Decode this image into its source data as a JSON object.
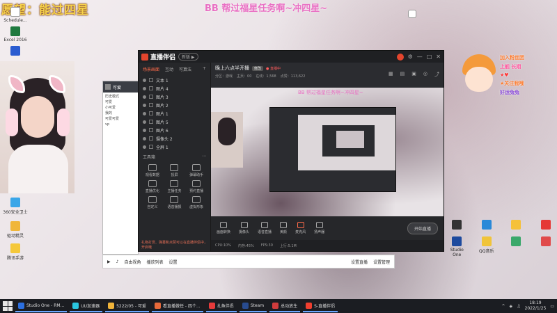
{
  "overlay": {
    "left_title": "愿望：能过四星",
    "center_title": "BB 帮过福星任务啊~冲四星~"
  },
  "desktop_left_icons": [
    {
      "label": "Schedule...",
      "icon": "doc-icon"
    },
    {
      "label": "Excel 2016",
      "icon": "excel-icon"
    },
    {
      "label": "",
      "icon": "word-icon"
    },
    {
      "label": "360安全卫士",
      "icon": "shield-icon"
    },
    {
      "label": "驱动精灵",
      "icon": "driver-icon"
    },
    {
      "label": "腾讯手游",
      "icon": "game-icon"
    }
  ],
  "chat_window": {
    "title": "可爱",
    "rows": [
      "历史模式",
      "可爱",
      "小可爱",
      "我的",
      "可爱可爱",
      "vp"
    ]
  },
  "main_window": {
    "app_name": "直播伴侣",
    "version_pill": "新版 ▶",
    "left_tabs": [
      "场景画面",
      "互动",
      "可算法"
    ],
    "scenes": [
      "文本 1",
      "图片 4",
      "图片 3",
      "图片 2",
      "图片 1",
      "图片 5",
      "图片 6",
      "摄像头 2",
      "全屏 1"
    ],
    "tools_title": "工具箱",
    "tools": [
      "观看数据",
      "投屏",
      "弹幕助手",
      "直播优化",
      "主播任务",
      "预约直播",
      "自定义",
      "语音播报",
      "虚拟形象",
      "PK",
      "话题",
      "连麦"
    ],
    "left_footer": "礼物打赏、弹幕和点赞可以在直播伴侣中，开启哦",
    "stream_title": "晚上六点半开播",
    "stream_badge": "修改",
    "stream_live": "● 直播中",
    "stream_sub": [
      "分区：游戏",
      "主页：00",
      "在线：1,568",
      "点赞：113,622"
    ],
    "preview_caption": "BB 帮过福星任务啊~冲四星~",
    "controls": [
      "画面转换",
      "摄像头",
      "语音直播",
      "美颜",
      "麦克风",
      "扬声器"
    ],
    "start_label": "开始直播",
    "status": [
      "CPU:10%",
      "内存:45%",
      "FPS:30",
      "上行:5.1M"
    ]
  },
  "under_bar": {
    "items": [
      "自由视角",
      "播放列表",
      "设置",
      "设置直播",
      "设置管理"
    ]
  },
  "right_overlay": {
    "lines": [
      {
        "text": "加入粉丝团",
        "color": "#ff7a2a"
      },
      {
        "text": "上舰 长期",
        "color": "#ff5aa0"
      },
      {
        "text": "★♥",
        "color": "#ff3a3a"
      },
      {
        "text": "★关注我哦",
        "color": "#ff7a2a"
      },
      {
        "text": "好运兔兔",
        "color": "#8a4bd8"
      }
    ]
  },
  "desktop_right_icons": [
    {
      "label": "",
      "icon": "app-icon-1"
    },
    {
      "label": "",
      "icon": "app-icon-2"
    },
    {
      "label": "",
      "icon": "app-icon-3"
    },
    {
      "label": "",
      "icon": "app-icon-4"
    },
    {
      "label": "",
      "icon": "app-icon-5"
    },
    {
      "label": "Studio One",
      "icon": "studio-icon"
    },
    {
      "label": "QQ音乐",
      "icon": "music-icon"
    },
    {
      "label": "",
      "icon": "app-icon-6"
    },
    {
      "label": "",
      "icon": "app-icon-7"
    },
    {
      "label": "",
      "icon": "app-icon-8"
    }
  ],
  "taskbar": {
    "apps": [
      {
        "label": "Studio One - RM...",
        "color": "#2b6fe0"
      },
      {
        "label": "UU加速器",
        "color": "#2ac7e0"
      },
      {
        "label": "5222/05 - 可爱",
        "color": "#f0b43a"
      },
      {
        "label": "看直播做任 - 四个...",
        "color": "#e86a3a"
      },
      {
        "label": "扎鱼伴侣",
        "color": "#e63b3b"
      },
      {
        "label": "Steam",
        "color": "#284b8f"
      },
      {
        "label": "总动放生",
        "color": "#d03c3c"
      },
      {
        "label": "S-直播伴侣",
        "color": "#f03f2f"
      }
    ],
    "time": "18:19",
    "date": "2022/1/25"
  }
}
